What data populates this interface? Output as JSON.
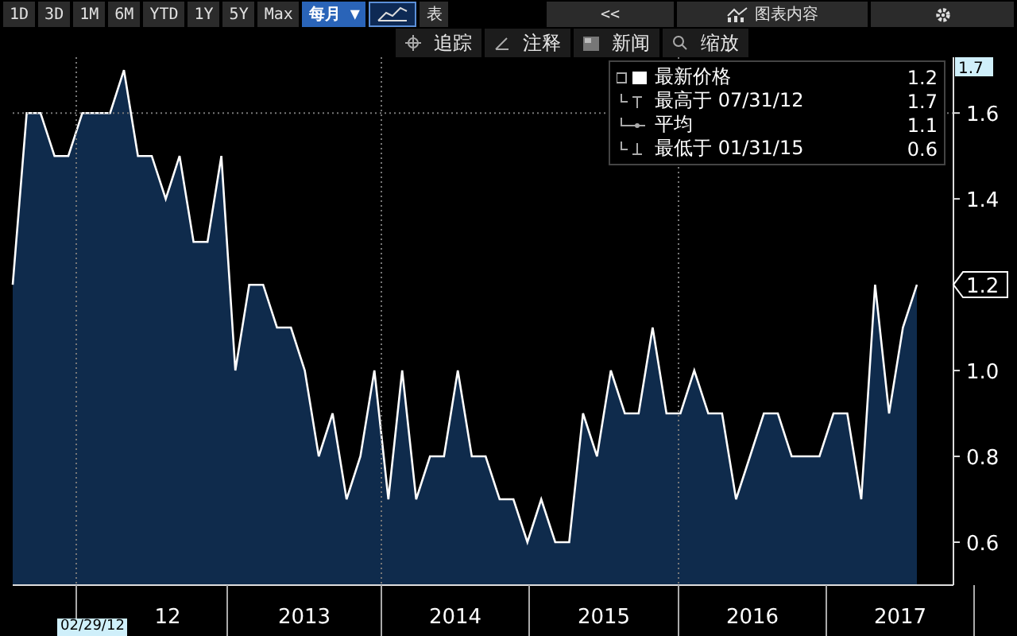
{
  "toolbar": {
    "ranges": [
      {
        "label": "1D",
        "selected": false
      },
      {
        "label": "3D",
        "selected": false
      },
      {
        "label": "1M",
        "selected": false
      },
      {
        "label": "6M",
        "selected": false
      },
      {
        "label": "YTD",
        "selected": false
      },
      {
        "label": "1Y",
        "selected": false
      },
      {
        "label": "5Y",
        "selected": false
      },
      {
        "label": "Max",
        "selected": false
      }
    ],
    "period": "每月 ▼",
    "table_button": "表",
    "collapse_button": "<<",
    "chart_content_button": "图表内容"
  },
  "tools": [
    {
      "kind": "track",
      "label": "追踪"
    },
    {
      "kind": "annotate",
      "label": "注释"
    },
    {
      "kind": "news",
      "label": "新闻"
    },
    {
      "kind": "zoom",
      "label": "缩放"
    }
  ],
  "legend": [
    {
      "kind": "last",
      "label": "最新价格",
      "value": "1.2"
    },
    {
      "kind": "high",
      "label": "最高于 07/31/12",
      "value": "1.7"
    },
    {
      "kind": "average",
      "label": "平均",
      "value": "1.1"
    },
    {
      "kind": "low",
      "label": "最低于 01/31/15",
      "value": "0.6"
    }
  ],
  "cursor_label": "02/29/12",
  "axis_tags": [
    {
      "kind": "high",
      "label": "1.7"
    },
    {
      "kind": "last",
      "label": "1.2"
    }
  ],
  "year_labels": [
    "12",
    "2013",
    "2014",
    "2015",
    "2016",
    "2017"
  ],
  "chart_data": {
    "type": "area",
    "ylim": [
      0.5,
      1.73
    ],
    "yticks": [
      0.6,
      0.8,
      {
        "value": 1,
        "label": "1.0"
      },
      1.2,
      1.4,
      1.6
    ],
    "series": [
      {
        "color": "#ffffff",
        "values": [
          1.2,
          1.6,
          1.6,
          1.5,
          1.5,
          1.6,
          1.6,
          1.6,
          1.7,
          1.5,
          1.5,
          1.4,
          1.5,
          1.3,
          1.3,
          1.5,
          1.0,
          1.2,
          1.2,
          1.1,
          1.1,
          1.0,
          0.8,
          0.9,
          0.7,
          0.8,
          1.0,
          0.7,
          1.0,
          0.7,
          0.8,
          0.8,
          1.0,
          0.8,
          0.8,
          0.7,
          0.7,
          0.6,
          0.7,
          0.6,
          0.6,
          0.9,
          0.8,
          1.0,
          0.9,
          0.9,
          1.1,
          0.9,
          0.9,
          1.0,
          0.9,
          0.9,
          0.7,
          0.8,
          0.9,
          0.9,
          0.8,
          0.8,
          0.8,
          0.9,
          0.9,
          0.7,
          1.2,
          0.9,
          1.1,
          1.2
        ]
      }
    ]
  }
}
